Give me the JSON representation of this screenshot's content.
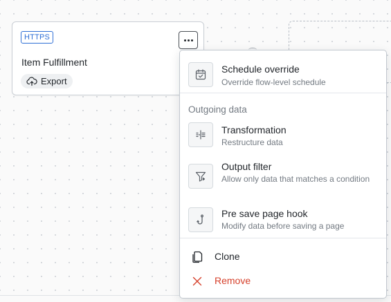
{
  "node": {
    "badge": "HTTPS",
    "title": "Item Fulfillment",
    "export_label": "Export"
  },
  "menu": {
    "schedule": {
      "title": "Schedule override",
      "subtitle": "Override flow-level schedule"
    },
    "section_label": "Outgoing data",
    "transformation": {
      "title": "Transformation",
      "subtitle": "Restructure data"
    },
    "output_filter": {
      "title": "Output filter",
      "subtitle": "Allow only data that matches a condition"
    },
    "pre_save": {
      "title": "Pre save page hook",
      "subtitle": "Modify data before saving a page"
    },
    "clone_label": "Clone",
    "remove_label": "Remove"
  },
  "colors": {
    "accent_blue": "#2f6fd6",
    "danger_red": "#d6402b",
    "text_primary": "#1f2328",
    "text_secondary": "#737a82"
  }
}
